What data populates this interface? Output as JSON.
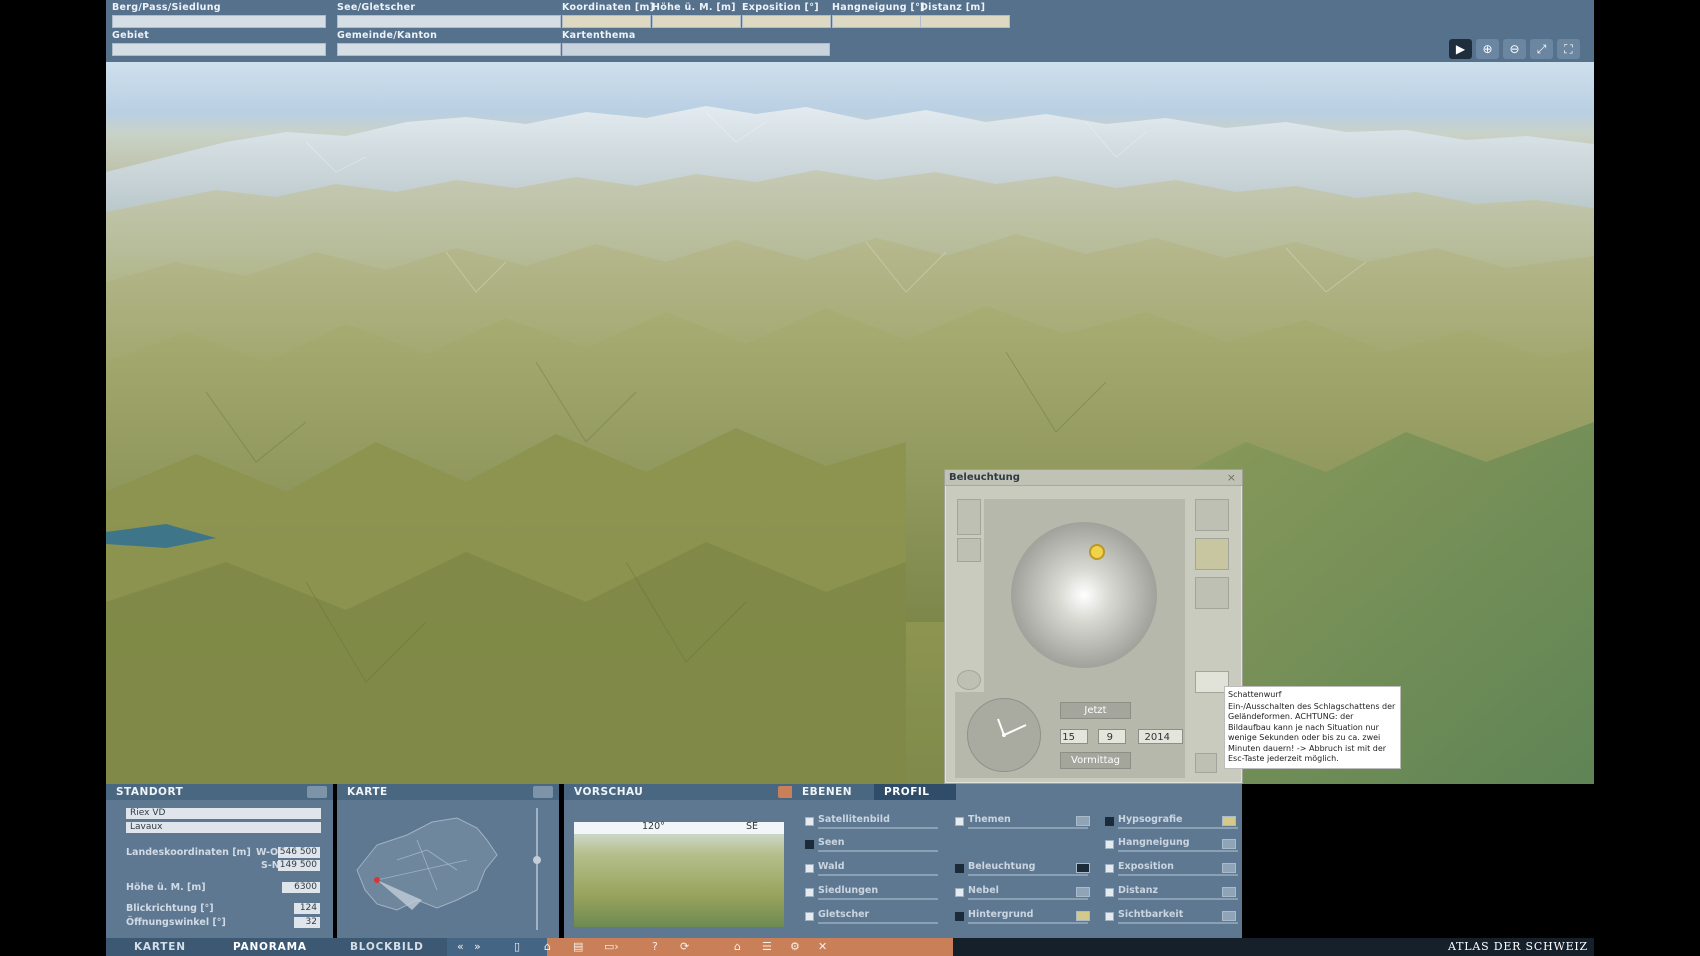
{
  "topbar": {
    "labels": {
      "berg": "Berg/Pass/Siedlung",
      "see": "See/Gletscher",
      "koordinaten": "Koordinaten [m]",
      "hoehe": "Höhe ü. M. [m]",
      "exposition": "Exposition [°]",
      "hangneigung": "Hangneigung [°]",
      "distanz": "Distanz [m]",
      "gebiet": "Gebiet",
      "gemeinde": "Gemeinde/Kanton",
      "kartenthema": "Kartenthema"
    }
  },
  "toolbar": {
    "icons": [
      "play-icon",
      "zoom-in-icon",
      "zoom-out-icon",
      "fit-view-icon",
      "fullscreen-icon"
    ]
  },
  "beleuchtung": {
    "title": "Beleuchtung",
    "close": "×",
    "jetzt": "Jetzt",
    "day": "15",
    "month": "9",
    "year": "2014",
    "period": "Vormittag"
  },
  "tooltip": {
    "title": "Schattenwurf",
    "text": "Ein-/Ausschalten des Schlagschattens der Geländeformen. ACHTUNG: der Bildaufbau kann je nach Situation nur wenige Sekunden oder bis zu ca. zwei Minuten dauern! -> Abbruch ist mit der Esc-Taste jederzeit möglich."
  },
  "standort": {
    "header": "STANDORT",
    "place": "Riex VD",
    "region": "Lavaux",
    "landeskoord_label": "Landeskoordinaten [m]",
    "wo_label": "W-O",
    "wo_value": "546 500",
    "sn_label": "S-N",
    "sn_value": "149 500",
    "hoehe_label": "Höhe ü. M. [m]",
    "hoehe_value": "6300",
    "blick_label": "Blickrichtung [°]",
    "blick_value": "124",
    "oeffnung_label": "Öffnungswinkel [°]",
    "oeffnung_value": "32"
  },
  "karte": {
    "header": "KARTE"
  },
  "vorschau": {
    "header": "VORSCHAU",
    "angle": "120°",
    "dir": "SE"
  },
  "ebenen": {
    "tabs": [
      "EBENEN",
      "PROFIL"
    ],
    "col1": [
      "Satellitenbild",
      "Seen",
      "Wald",
      "Siedlungen",
      "Gletscher"
    ],
    "col2": [
      "Themen",
      "Beleuchtung",
      "Nebel",
      "Hintergrund"
    ],
    "col3": [
      "Hypsografie",
      "Hangneigung",
      "Exposition",
      "Distanz",
      "Sichtbarkeit"
    ]
  },
  "nav": {
    "karten": "KARTEN",
    "panorama": "PANORAMA",
    "blockbild": "BLOCKBILD",
    "brand": "ATLAS DER SCHWEIZ"
  },
  "colors": {
    "accent": "#c98058",
    "panel": "#5f7891",
    "header": "#4a6782"
  }
}
